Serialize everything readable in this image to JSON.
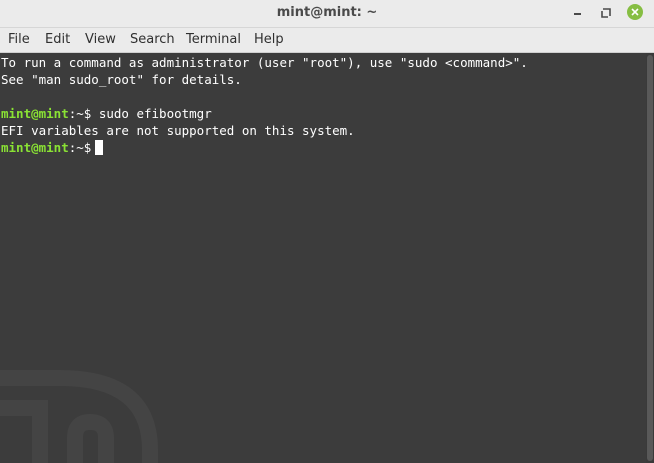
{
  "window": {
    "title": "mint@mint: ~"
  },
  "menubar": {
    "items": [
      "File",
      "Edit",
      "View",
      "Search",
      "Terminal",
      "Help"
    ]
  },
  "terminal": {
    "lines": [
      "To run a command as administrator (user \"root\"), use \"sudo <command>\".",
      "See \"man sudo_root\" for details.",
      "",
      "EFI variables are not supported on this system."
    ],
    "prompt_user_host": "mint@mint",
    "prompt_path": ":~$",
    "command": " sudo efibootmgr",
    "colors": {
      "background": "#3c3c3c",
      "prompt_green": "#8ae234",
      "text": "#ffffff"
    }
  },
  "icons": {
    "minimize": "minimize-icon",
    "maximize": "maximize-icon",
    "close": "close-icon",
    "watermark": "linux-mint-logo-icon"
  }
}
